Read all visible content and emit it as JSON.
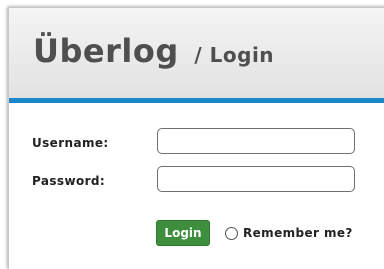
{
  "header": {
    "brand": "Überlog",
    "subtitle": "/ Login",
    "accent_color": "#1b87c9"
  },
  "form": {
    "username_label": "Username:",
    "username_value": "",
    "password_label": "Password:",
    "password_value": "",
    "login_label": "Login",
    "login_color": "#3d8f3d",
    "remember_label": "Remember me?",
    "remember_checked": false
  }
}
